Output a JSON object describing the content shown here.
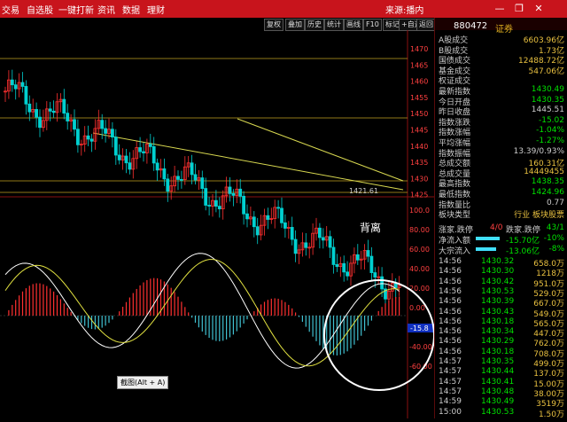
{
  "menu": [
    "交易",
    "自选股",
    "一键打新",
    "资讯",
    "数据",
    "理财"
  ],
  "app_title": "来源:播内",
  "window_buttons": [
    "minimize-icon",
    "restore-icon",
    "close-icon"
  ],
  "toolbar": [
    "复权",
    "叠加",
    "历史",
    "统计",
    "画线",
    "F10",
    "标记",
    "+自选",
    "返回"
  ],
  "price_axis": [
    "1470",
    "1465",
    "1460",
    "1455",
    "1450",
    "1445",
    "1440",
    "1435",
    "1430",
    "1425"
  ],
  "indicator_axis": [
    "100.0",
    "80.00",
    "60.00",
    "40.00",
    "20.00",
    "0.00",
    "-20.00",
    "-40.00",
    "-60.00"
  ],
  "low_label": "1421.61",
  "annotation": "背离",
  "tooltip": "截图(Alt + A)",
  "indicator_value": "-15.8",
  "stock": {
    "code": "880472",
    "name": "证券"
  },
  "stats": [
    {
      "label": "A股成交",
      "value": "6603.96亿",
      "color": "#e8c040"
    },
    {
      "label": "B股成交",
      "value": "1.73亿",
      "color": "#e8c040"
    },
    {
      "label": "国债成交",
      "value": "12488.72亿",
      "color": "#e8c040"
    },
    {
      "label": "基金成交",
      "value": "547.06亿",
      "color": "#e8c040"
    },
    {
      "label": "权证成交",
      "value": "",
      "color": "#e8c040"
    },
    {
      "label": "最新指数",
      "value": "1430.49",
      "color": "#00e000"
    },
    {
      "label": "今日开盘",
      "value": "1430.35",
      "color": "#00e000"
    },
    {
      "label": "昨日收盘",
      "value": "1445.51",
      "color": "#cccccc"
    },
    {
      "label": "指数涨跌",
      "value": "-15.02",
      "color": "#00e000"
    },
    {
      "label": "指数涨幅",
      "value": "-1.04%",
      "color": "#00e000"
    },
    {
      "label": "平均涨幅",
      "value": "-1.27%",
      "color": "#00e000"
    },
    {
      "label": "指数振幅",
      "value": "13.39/0.93%",
      "color": "#cccccc"
    },
    {
      "label": "总成交额",
      "value": "160.31亿",
      "color": "#e8c040"
    },
    {
      "label": "总成交量",
      "value": "14449455",
      "color": "#e8c040"
    },
    {
      "label": "最高指数",
      "value": "1438.35",
      "color": "#00e000"
    },
    {
      "label": "最低指数",
      "value": "1424.96",
      "color": "#00e000"
    },
    {
      "label": "指数量比",
      "value": "0.77",
      "color": "#cccccc"
    },
    {
      "label": "板块类型",
      "value": "行业 板块股票",
      "color": "#e8c040"
    }
  ],
  "updown": {
    "label": "涨家.跌停",
    "up": "4/0",
    "down_label": "跌家.跌停",
    "down": "43/1"
  },
  "flows": [
    {
      "label": "净流入额",
      "value": "-15.70亿",
      "pct": "-10%",
      "bar": 0.6
    },
    {
      "label": "大宗流入",
      "value": "-13.06亿",
      "pct": "-8%",
      "bar": 0.5
    }
  ],
  "ticks": [
    {
      "time": "14:56",
      "price": "1430.32",
      "vol": "658.0万"
    },
    {
      "time": "14:56",
      "price": "1430.30",
      "vol": "1218万"
    },
    {
      "time": "14:56",
      "price": "1430.42",
      "vol": "951.0万"
    },
    {
      "time": "14:56",
      "price": "1430.53",
      "vol": "529.0万"
    },
    {
      "time": "14:56",
      "price": "1430.39",
      "vol": "667.0万"
    },
    {
      "time": "14:56",
      "price": "1430.43",
      "vol": "549.0万"
    },
    {
      "time": "14:56",
      "price": "1430.18",
      "vol": "565.0万"
    },
    {
      "time": "14:56",
      "price": "1430.34",
      "vol": "447.0万"
    },
    {
      "time": "14:56",
      "price": "1430.29",
      "vol": "762.0万"
    },
    {
      "time": "14:56",
      "price": "1430.18",
      "vol": "708.0万"
    },
    {
      "time": "14:57",
      "price": "1430.35",
      "vol": "499.0万"
    },
    {
      "time": "14:57",
      "price": "1430.44",
      "vol": "137.0万"
    },
    {
      "time": "14:57",
      "price": "1430.41",
      "vol": "15.00万"
    },
    {
      "time": "14:57",
      "price": "1430.48",
      "vol": "38.00万"
    },
    {
      "time": "14:59",
      "price": "1430.49",
      "vol": "3519万"
    },
    {
      "time": "15:00",
      "price": "1430.53",
      "vol": "1.50万"
    }
  ]
}
